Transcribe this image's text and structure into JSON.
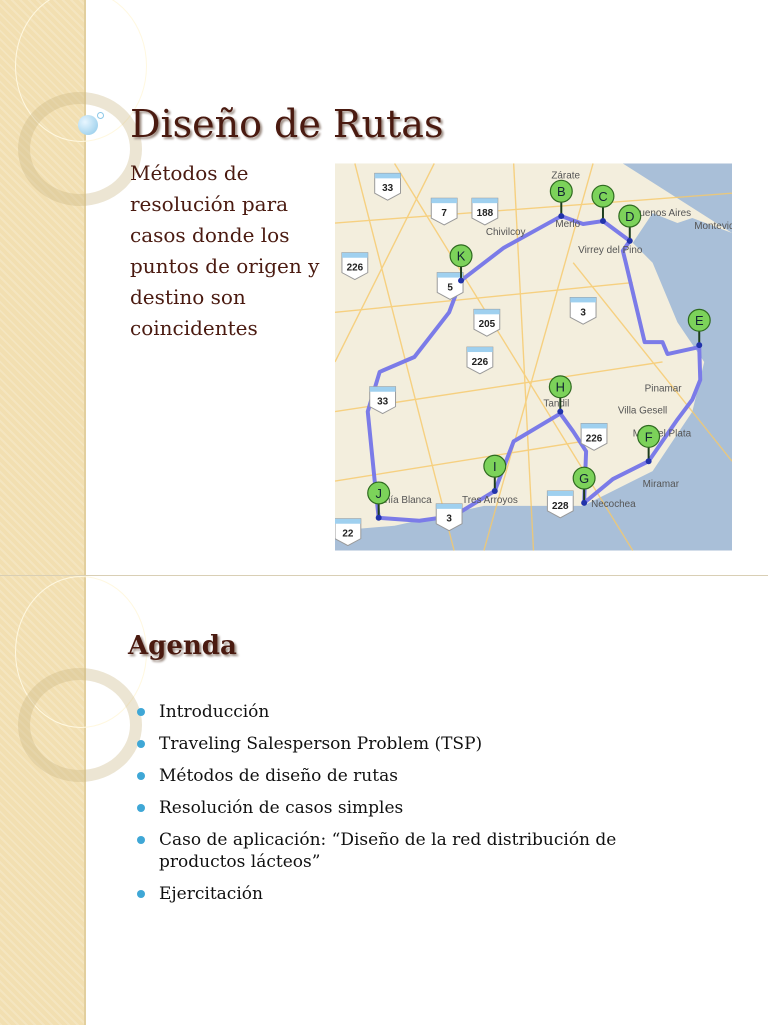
{
  "slide1": {
    "title": "Diseño de Rutas",
    "subtitle": "Métodos de resolución para casos donde los puntos de origen y destino son coincidentes",
    "map": {
      "markers": [
        "B",
        "C",
        "D",
        "E",
        "F",
        "G",
        "H",
        "I",
        "J",
        "K"
      ],
      "route_signs": [
        "33",
        "7",
        "188",
        "226",
        "5",
        "205",
        "226",
        "3",
        "33",
        "226",
        "228",
        "3",
        "22"
      ],
      "places": [
        "Zárate",
        "Merlo",
        "Chivilcoy",
        "Virrey del Pino",
        "Buenos Aires",
        "Montevideo",
        "Pinamar",
        "Villa Gesell",
        "Tandil",
        "Mar del Plata",
        "Miramar",
        "Necochea",
        "Tres Arroyos",
        "Bahía Blanca"
      ],
      "route_color": "#7b7be8"
    }
  },
  "slide2": {
    "heading": "Agenda",
    "items": [
      "Introducción",
      "Traveling Salesperson Problem (TSP)",
      "Métodos de diseño de rutas",
      "Resolución de casos simples",
      "Caso de aplicación: “Diseño de la red distribución de productos lácteos”",
      "Ejercitación"
    ]
  }
}
